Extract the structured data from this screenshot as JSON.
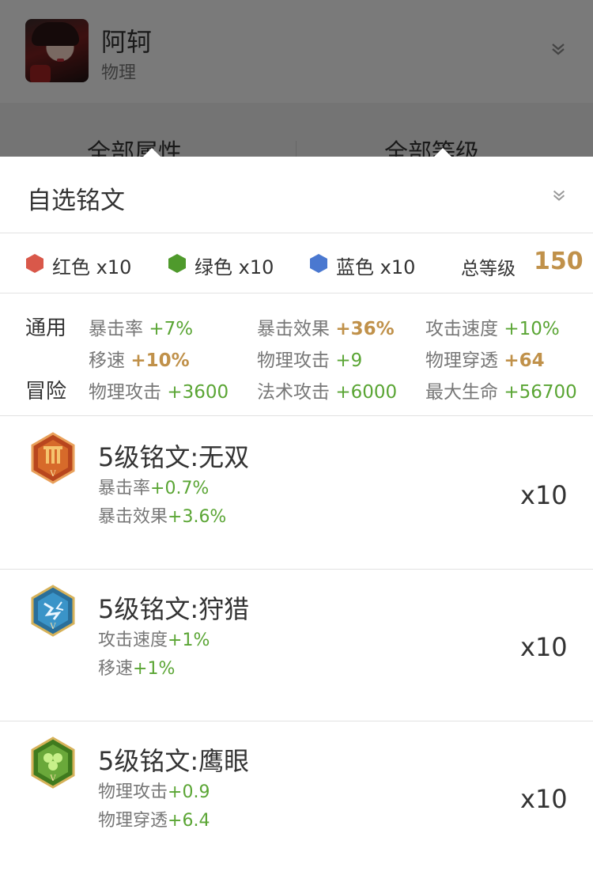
{
  "hero": {
    "name": "阿轲",
    "type": "物理"
  },
  "filters": {
    "attribute": "全部属性",
    "level": "全部等级"
  },
  "panel": {
    "title": "自选铭文"
  },
  "colors": {
    "red": {
      "label": "红色 x10",
      "hex": "#d9584a"
    },
    "green": {
      "label": "绿色 x10",
      "hex": "#4f9a2c"
    },
    "blue": {
      "label": "蓝色 x10",
      "hex": "#4a78d0"
    }
  },
  "total": {
    "label": "总等级",
    "value": "150"
  },
  "accent_colors": {
    "gold": "#c0914a",
    "green": "#5aa534"
  },
  "attributes": {
    "general": {
      "label": "通用",
      "items": [
        {
          "name": "暴击率",
          "value": "+7%",
          "highlight": false
        },
        {
          "name": "暴击效果",
          "value": "+36%",
          "highlight": true
        },
        {
          "name": "攻击速度",
          "value": "+10%",
          "highlight": false
        },
        {
          "name": "移速",
          "value": "+10%",
          "highlight": true
        },
        {
          "name": "物理攻击",
          "value": "+9",
          "highlight": false
        },
        {
          "name": "物理穿透",
          "value": "+64",
          "highlight": true
        }
      ]
    },
    "adventure": {
      "label": "冒险",
      "items": [
        {
          "name": "物理攻击",
          "value": "+3600",
          "highlight": false
        },
        {
          "name": "法术攻击",
          "value": "+6000",
          "highlight": false
        },
        {
          "name": "最大生命",
          "value": "+56700",
          "highlight": false
        }
      ]
    }
  },
  "runes": [
    {
      "name": "5级铭文:无双",
      "icon": "red-rune-icon",
      "count": "x10",
      "stats": [
        {
          "name": "暴击率",
          "value": "+0.7%"
        },
        {
          "name": "暴击效果",
          "value": "+3.6%"
        }
      ]
    },
    {
      "name": "5级铭文:狩猎",
      "icon": "blue-rune-icon",
      "count": "x10",
      "stats": [
        {
          "name": "攻击速度",
          "value": "+1%"
        },
        {
          "name": "移速",
          "value": "+1%"
        }
      ]
    },
    {
      "name": "5级铭文:鹰眼",
      "icon": "green-rune-icon",
      "count": "x10",
      "stats": [
        {
          "name": "物理攻击",
          "value": "+0.9"
        },
        {
          "name": "物理穿透",
          "value": "+6.4"
        }
      ]
    }
  ]
}
